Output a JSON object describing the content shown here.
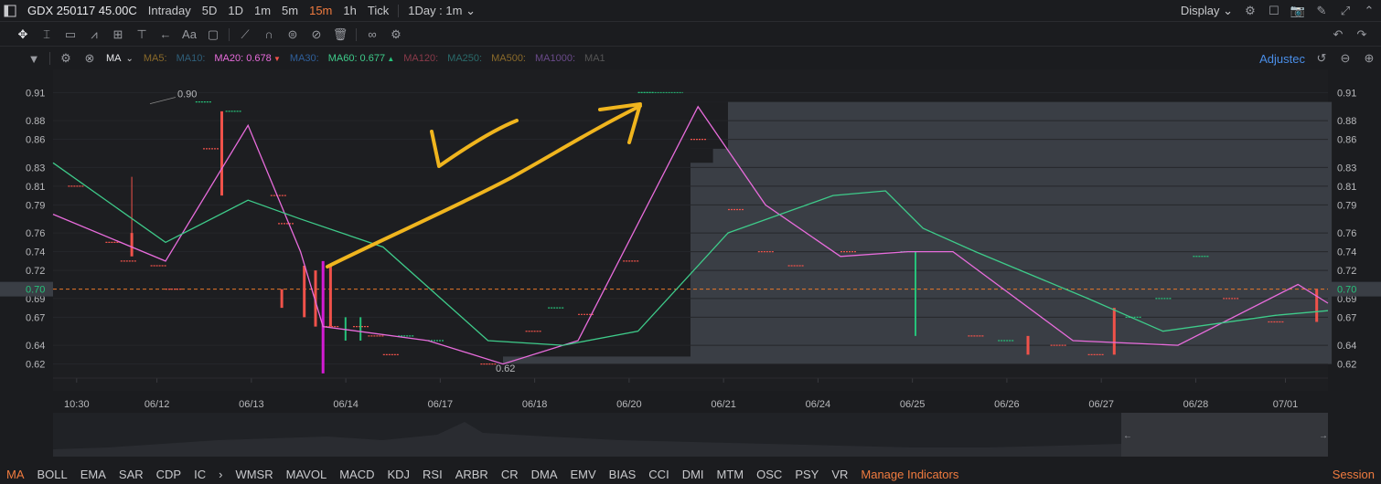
{
  "header": {
    "symbol": "GDX 250117 45.00C",
    "tabs": [
      "Intraday",
      "5D",
      "1D",
      "1m",
      "5m",
      "15m",
      "1h",
      "Tick"
    ],
    "active_tab": "15m",
    "range": "1Day : 1m",
    "display_label": "Display"
  },
  "ma_bar": {
    "name": "MA",
    "items": [
      {
        "label": "MA5:",
        "value": "",
        "color": "#8a6a2a"
      },
      {
        "label": "MA10:",
        "value": "",
        "color": "#2f5f7a"
      },
      {
        "label": "MA20:",
        "value": "0.678",
        "color": "#e86cdc",
        "arrow": "▼"
      },
      {
        "label": "MA30:",
        "value": "",
        "color": "#2f5f9a"
      },
      {
        "label": "MA60:",
        "value": "0.677",
        "color": "#3ecb8a",
        "arrow": "▲"
      },
      {
        "label": "MA120:",
        "value": "",
        "color": "#8a3a4a"
      },
      {
        "label": "MA250:",
        "value": "",
        "color": "#2a6a6a"
      },
      {
        "label": "MA500:",
        "value": "",
        "color": "#8a6a2a"
      },
      {
        "label": "MA1000:",
        "value": "",
        "color": "#6a4a8a"
      },
      {
        "label": "MA1",
        "value": "",
        "color": "#555"
      }
    ],
    "adjusted": "Adjustec"
  },
  "chart_data": {
    "type": "candlestick",
    "y_ticks": [
      "0.91",
      "0.88",
      "0.86",
      "0.83",
      "0.81",
      "0.79",
      "0.76",
      "0.74",
      "0.72",
      "0.69",
      "0.67",
      "0.64",
      "0.62"
    ],
    "ylim": [
      0.605,
      0.925
    ],
    "x_ticks": [
      "10:30",
      "06/12",
      "06/13",
      "06/14",
      "06/17",
      "06/18",
      "06/20",
      "06/21",
      "06/24",
      "06/25",
      "06/26",
      "06/27",
      "06/28",
      "07/01"
    ],
    "current_price": "0.70",
    "high_annotation": "0.90",
    "low_annotation": "0.62",
    "series": [
      {
        "name": "MA20",
        "value": "0.678",
        "color": "#e86cdc",
        "points": [
          [
            0,
            0.78
          ],
          [
            1.5,
            0.73
          ],
          [
            2.6,
            0.875
          ],
          [
            3.3,
            0.74
          ],
          [
            3.6,
            0.66
          ],
          [
            5,
            0.645
          ],
          [
            6,
            0.62
          ],
          [
            7,
            0.645
          ],
          [
            8.6,
            0.895
          ],
          [
            9.5,
            0.79
          ],
          [
            10.5,
            0.735
          ],
          [
            11.4,
            0.74
          ],
          [
            12,
            0.74
          ],
          [
            13.6,
            0.645
          ],
          [
            15,
            0.64
          ],
          [
            16.6,
            0.705
          ],
          [
            17,
            0.685
          ]
        ]
      },
      {
        "name": "MA60",
        "value": "0.677",
        "color": "#3ecb8a",
        "points": [
          [
            0,
            0.835
          ],
          [
            1.5,
            0.75
          ],
          [
            2.6,
            0.795
          ],
          [
            3.3,
            0.775
          ],
          [
            4.4,
            0.745
          ],
          [
            5.8,
            0.645
          ],
          [
            6.8,
            0.64
          ],
          [
            7.8,
            0.655
          ],
          [
            9,
            0.76
          ],
          [
            10.4,
            0.8
          ],
          [
            11.1,
            0.805
          ],
          [
            11.6,
            0.765
          ],
          [
            12.3,
            0.74
          ],
          [
            13.8,
            0.69
          ],
          [
            14.8,
            0.655
          ],
          [
            16.3,
            0.672
          ],
          [
            17,
            0.677
          ]
        ]
      }
    ]
  },
  "indicators": [
    "MA",
    "BOLL",
    "EMA",
    "SAR",
    "CDP",
    "IC",
    "WMSR",
    "MAVOL",
    "MACD",
    "KDJ",
    "RSI",
    "ARBR",
    "CR",
    "DMA",
    "EMV",
    "BIAS",
    "CCI",
    "DMI",
    "MTM",
    "OSC",
    "PSY",
    "VR"
  ],
  "manage_indicators": "Manage Indicators",
  "session_label": "Session",
  "colors": {
    "up": "#f0524a",
    "down": "#26c27a",
    "shade": "#3a3e45",
    "arrow": "#f0b51e",
    "price_line": "#e8782a"
  }
}
